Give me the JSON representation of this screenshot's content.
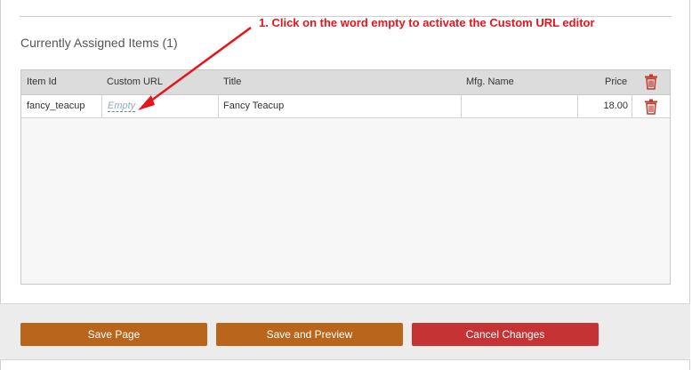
{
  "section": {
    "title": "Currently Assigned Items (1)"
  },
  "annotation": {
    "text": "1. Click on the word empty to activate the Custom URL editor"
  },
  "table": {
    "headers": {
      "item_id": "Item Id",
      "custom_url": "Custom URL",
      "title": "Title",
      "mfg_name": "Mfg. Name",
      "price": "Price"
    },
    "rows": [
      {
        "item_id": "fancy_teacup",
        "custom_url": "Empty",
        "title": "Fancy Teacup",
        "mfg_name": "",
        "price": "18.00"
      }
    ]
  },
  "footer": {
    "save_label": "Save Page",
    "preview_label": "Save and Preview",
    "cancel_label": "Cancel Changes"
  },
  "colors": {
    "accent_orange": "#b9651b",
    "danger_red": "#c53335",
    "annotation_red": "#e8141a",
    "trash_red": "#c0392b"
  },
  "icons": {
    "delete": "trash-icon",
    "pointer": "arrow-annotation"
  }
}
